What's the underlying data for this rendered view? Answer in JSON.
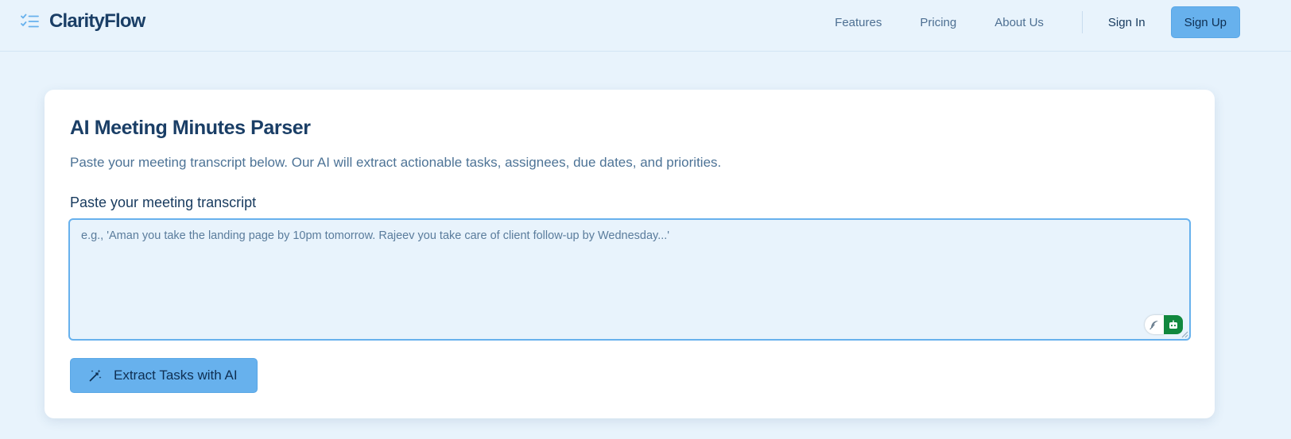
{
  "header": {
    "brand_name": "ClarityFlow",
    "brand_icon": "task-list-icon",
    "nav_links": [
      "Features",
      "Pricing",
      "About Us"
    ],
    "sign_in_label": "Sign In",
    "sign_up_label": "Sign Up"
  },
  "main": {
    "title": "AI Meeting Minutes Parser",
    "description": "Paste your meeting transcript below. Our AI will extract actionable tasks, assignees, due dates, and priorities.",
    "transcript_label": "Paste your meeting transcript",
    "transcript_placeholder": "e.g., 'Aman you take the landing page by 10pm tomorrow. Rajeev you take care of client follow-up by Wednesday...'",
    "transcript_value": "",
    "extract_button_label": "Extract Tasks with AI",
    "extract_button_icon": "magic-wand-icon"
  },
  "colors": {
    "page_background": "#e8f3fc",
    "brand_text": "#1a3e66",
    "accent": "#67b1ed",
    "card_background": "#ffffff",
    "muted_text": "#4d7396",
    "extension_green": "#11883e"
  }
}
